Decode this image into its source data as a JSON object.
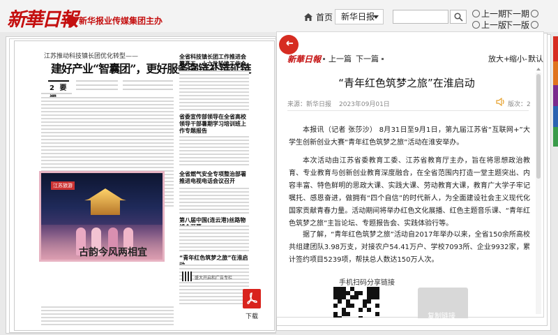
{
  "header": {
    "logo_text": "新華日報",
    "logo_sub": "新华报业传媒集团主办",
    "home_label": "首页",
    "edition_select": "新华日报",
    "search_placeholder": "",
    "nav": {
      "prev_issue": "上一期",
      "next_issue": "下一期",
      "prev_page": "上一版",
      "next_page": "下一版"
    }
  },
  "paper": {
    "kicker": "江苏推动科技镇长团优化转型——",
    "headline": "建好产业“智囊团”，更好服务强链补链延链",
    "page_no": "2",
    "page_tag": "要闻",
    "side_headlines": [
      "全省科技镇长团工作推进会召开",
      "第十五、十六批轮换工作会议召开",
      "省委宣传部领导在全省高校领导干部暑期学习培训班上作专题报告",
      "全省燃气安全专项整治部署推进电视电话会议召开",
      "第八届中国(连云港)丝路物博会开幕",
      "“青年红色筑梦之旅”在淮启动"
    ],
    "photo_tag": "江苏旅游",
    "photo_title": "古韵今风两相宜",
    "bottom_note": "盛大开启和广告专栏",
    "download_label": "下载"
  },
  "article": {
    "brand": "新華日報",
    "prev_label": "上一篇",
    "next_label": "下一篇",
    "zoom_in": "放大+",
    "zoom_out": "缩小-",
    "zoom_default": "默认",
    "title": "“青年红色筑梦之旅”在淮启动",
    "source": "来源：新华日报",
    "date": "2023年09月01日",
    "edition": "版次：2",
    "paragraphs": [
      "本报讯（记者 张莎沙） 8月31日至9月1日，第九届江苏省“互联网+”大学生创新创业大赛“青年红色筑梦之旅”活动在淮安举办。",
      "本次活动由江苏省委教育工委、江苏省教育厅主办，旨在将思想政治教育、专业教育与创新创业教育深度融合，在全省范围内打造一堂主题突出、内容丰富、特色鲜明的思政大课、实践大课、劳动教育大课，教育广大学子牢记嘱托、感恩奋进，做拥有“四个自信”的时代新人，为全面建设社会主义现代化国家贡献青春力量。活动期间将举办红色文化展播、红色主题音乐课、“青年红色筑梦之旅”主旨论坛、专题报告会、实践体验行等。",
      "据了解，“青年红色筑梦之旅”活动自2017年举办以来，全省150余所高校共组建团队3.98万支，对接农户54.41万户、学校7093所、企业9932家，累计签约项目5239项，帮扶总人数达150万人次。"
    ],
    "qr_caption": "手机扫码分享链接",
    "copy_button": "复制链接"
  },
  "colors": {
    "brand_red": "#c40f0f",
    "tabs": [
      "#d62c21",
      "#e0731e",
      "#7a2b8c",
      "#2b62b0",
      "#3a9b4a"
    ]
  }
}
